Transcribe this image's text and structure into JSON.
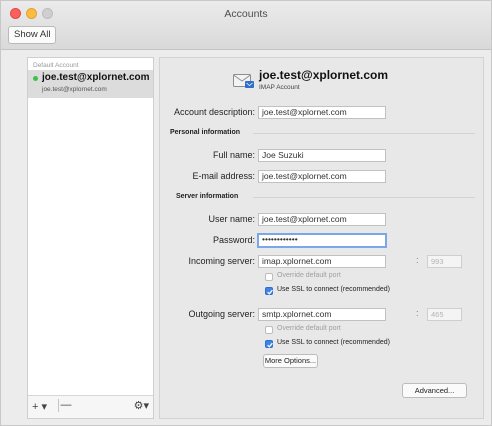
{
  "window": {
    "title": "Accounts"
  },
  "toolbar": {
    "show_all_label": "Show All"
  },
  "sidebar": {
    "section_label": "Default Account",
    "accounts": [
      {
        "name": "joe.test@xplornet.com",
        "email": "joe.test@xplornet.com",
        "status_color": "#3ec04a"
      }
    ],
    "add_label": "+ ▾",
    "remove_label": "—",
    "gear_label": "⚙▾"
  },
  "account": {
    "header_name": "joe.test@xplornet.com",
    "header_type": "IMAP Account",
    "description_label": "Account description:",
    "description_value": "joe.test@xplornet.com",
    "personal_section": "Personal information",
    "full_name_label": "Full name:",
    "full_name_value": "Joe Suzuki",
    "email_label": "E-mail address:",
    "email_value": "joe.test@xplornet.com",
    "server_section": "Server information",
    "user_name_label": "User name:",
    "user_name_value": "joe.test@xplornet.com",
    "password_label": "Password:",
    "password_value": "••••••••••••",
    "incoming_label": "Incoming server:",
    "incoming_value": "imap.xplornet.com",
    "incoming_port": "993",
    "incoming_override_label": "Override default port",
    "incoming_ssl_label": "Use SSL to connect (recommended)",
    "outgoing_label": "Outgoing server:",
    "outgoing_value": "smtp.xplornet.com",
    "outgoing_port": "465",
    "outgoing_override_label": "Override default port",
    "outgoing_ssl_label": "Use SSL to connect (recommended)",
    "more_options_label": "More Options...",
    "advanced_label": "Advanced...",
    "incoming_override_checked": false,
    "incoming_ssl_checked": true,
    "outgoing_override_checked": false,
    "outgoing_ssl_checked": true
  },
  "colors": {
    "accent": "#3e84e4",
    "focus_ring": "#7aa7e8",
    "status_online": "#3ec04a"
  },
  "icons": {
    "account": "mail-envelope-icon",
    "gear": "gear-icon",
    "add": "plus-icon",
    "remove": "minus-icon"
  }
}
